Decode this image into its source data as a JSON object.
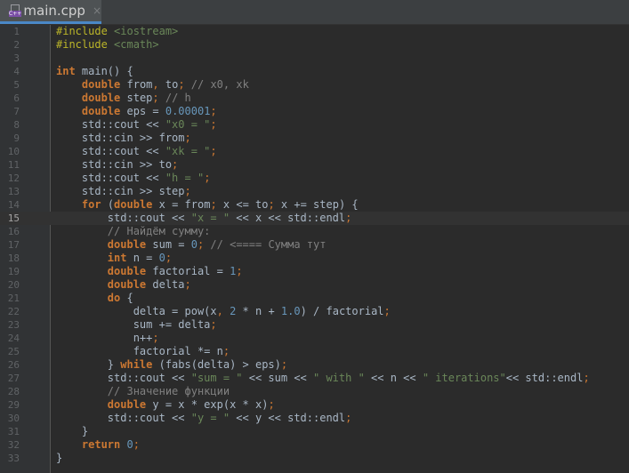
{
  "tab": {
    "name": "main.cpp",
    "icon_label": "C++",
    "close": "×"
  },
  "current_line": 15,
  "lines": [
    [
      [
        "pp",
        "#include "
      ],
      [
        "str",
        "<iostream>"
      ]
    ],
    [
      [
        "pp",
        "#include "
      ],
      [
        "str",
        "<cmath>"
      ]
    ],
    [],
    [
      [
        "kw",
        "int"
      ],
      [
        "t",
        " main() {"
      ]
    ],
    [
      [
        "t",
        "    "
      ],
      [
        "kw",
        "double"
      ],
      [
        "t",
        " from"
      ],
      [
        "punc",
        ","
      ],
      [
        "t",
        " to"
      ],
      [
        "punc",
        ";"
      ],
      [
        "com",
        " // x0, xk"
      ]
    ],
    [
      [
        "t",
        "    "
      ],
      [
        "kw",
        "double"
      ],
      [
        "t",
        " step"
      ],
      [
        "punc",
        ";"
      ],
      [
        "com",
        " // h"
      ]
    ],
    [
      [
        "t",
        "    "
      ],
      [
        "kw",
        "double"
      ],
      [
        "t",
        " eps = "
      ],
      [
        "num",
        "0.00001"
      ],
      [
        "punc",
        ";"
      ]
    ],
    [
      [
        "t",
        "    std::cout << "
      ],
      [
        "str",
        "\"x0 = \""
      ],
      [
        "punc",
        ";"
      ]
    ],
    [
      [
        "t",
        "    std::cin >> from"
      ],
      [
        "punc",
        ";"
      ]
    ],
    [
      [
        "t",
        "    std::cout << "
      ],
      [
        "str",
        "\"xk = \""
      ],
      [
        "punc",
        ";"
      ]
    ],
    [
      [
        "t",
        "    std::cin >> to"
      ],
      [
        "punc",
        ";"
      ]
    ],
    [
      [
        "t",
        "    std::cout << "
      ],
      [
        "str",
        "\"h = \""
      ],
      [
        "punc",
        ";"
      ]
    ],
    [
      [
        "t",
        "    std::cin >> step"
      ],
      [
        "punc",
        ";"
      ]
    ],
    [
      [
        "t",
        "    "
      ],
      [
        "kw",
        "for"
      ],
      [
        "t",
        " ("
      ],
      [
        "kw",
        "double"
      ],
      [
        "t",
        " x = from"
      ],
      [
        "punc",
        ";"
      ],
      [
        "t",
        " x <= to"
      ],
      [
        "punc",
        ";"
      ],
      [
        "t",
        " x += step) {"
      ]
    ],
    [
      [
        "t",
        "        std::cout << "
      ],
      [
        "str",
        "\"x = \""
      ],
      [
        "t",
        " << x << std::endl"
      ],
      [
        "punc",
        ";"
      ]
    ],
    [
      [
        "com",
        "        // Найдём сумму:"
      ]
    ],
    [
      [
        "t",
        "        "
      ],
      [
        "kw",
        "double"
      ],
      [
        "t",
        " sum = "
      ],
      [
        "num",
        "0"
      ],
      [
        "punc",
        ";"
      ],
      [
        "com",
        " // <==== Сумма тут"
      ]
    ],
    [
      [
        "t",
        "        "
      ],
      [
        "kw",
        "int"
      ],
      [
        "t",
        " n = "
      ],
      [
        "num",
        "0"
      ],
      [
        "punc",
        ";"
      ]
    ],
    [
      [
        "t",
        "        "
      ],
      [
        "kw",
        "double"
      ],
      [
        "t",
        " factorial = "
      ],
      [
        "num",
        "1"
      ],
      [
        "punc",
        ";"
      ]
    ],
    [
      [
        "t",
        "        "
      ],
      [
        "kw",
        "double"
      ],
      [
        "t",
        " delta"
      ],
      [
        "punc",
        ";"
      ]
    ],
    [
      [
        "t",
        "        "
      ],
      [
        "kw",
        "do"
      ],
      [
        "t",
        " {"
      ]
    ],
    [
      [
        "t",
        "            delta = pow(x"
      ],
      [
        "punc",
        ","
      ],
      [
        "t",
        " "
      ],
      [
        "num",
        "2"
      ],
      [
        "t",
        " * n + "
      ],
      [
        "num",
        "1.0"
      ],
      [
        "t",
        ") / factorial"
      ],
      [
        "punc",
        ";"
      ]
    ],
    [
      [
        "t",
        "            sum += delta"
      ],
      [
        "punc",
        ";"
      ]
    ],
    [
      [
        "t",
        "            n++"
      ],
      [
        "punc",
        ";"
      ]
    ],
    [
      [
        "t",
        "            factorial *= n"
      ],
      [
        "punc",
        ";"
      ]
    ],
    [
      [
        "t",
        "        } "
      ],
      [
        "kw",
        "while"
      ],
      [
        "t",
        " (fabs(delta) > eps)"
      ],
      [
        "punc",
        ";"
      ]
    ],
    [
      [
        "t",
        "        std::cout << "
      ],
      [
        "str",
        "\"sum = \""
      ],
      [
        "t",
        " << sum << "
      ],
      [
        "str",
        "\" with \""
      ],
      [
        "t",
        " << n << "
      ],
      [
        "str",
        "\" iterations\""
      ],
      [
        "t",
        "<< std::endl"
      ],
      [
        "punc",
        ";"
      ]
    ],
    [
      [
        "com",
        "        // Значение функции"
      ]
    ],
    [
      [
        "t",
        "        "
      ],
      [
        "kw",
        "double"
      ],
      [
        "t",
        " y = x * exp(x * x)"
      ],
      [
        "punc",
        ";"
      ]
    ],
    [
      [
        "t",
        "        std::cout << "
      ],
      [
        "str",
        "\"y = \""
      ],
      [
        "t",
        " << y << std::endl"
      ],
      [
        "punc",
        ";"
      ]
    ],
    [
      [
        "t",
        "    }"
      ]
    ],
    [
      [
        "t",
        "    "
      ],
      [
        "kw",
        "return"
      ],
      [
        "t",
        " "
      ],
      [
        "num",
        "0"
      ],
      [
        "punc",
        ";"
      ]
    ],
    [
      [
        "t",
        "}"
      ]
    ]
  ]
}
